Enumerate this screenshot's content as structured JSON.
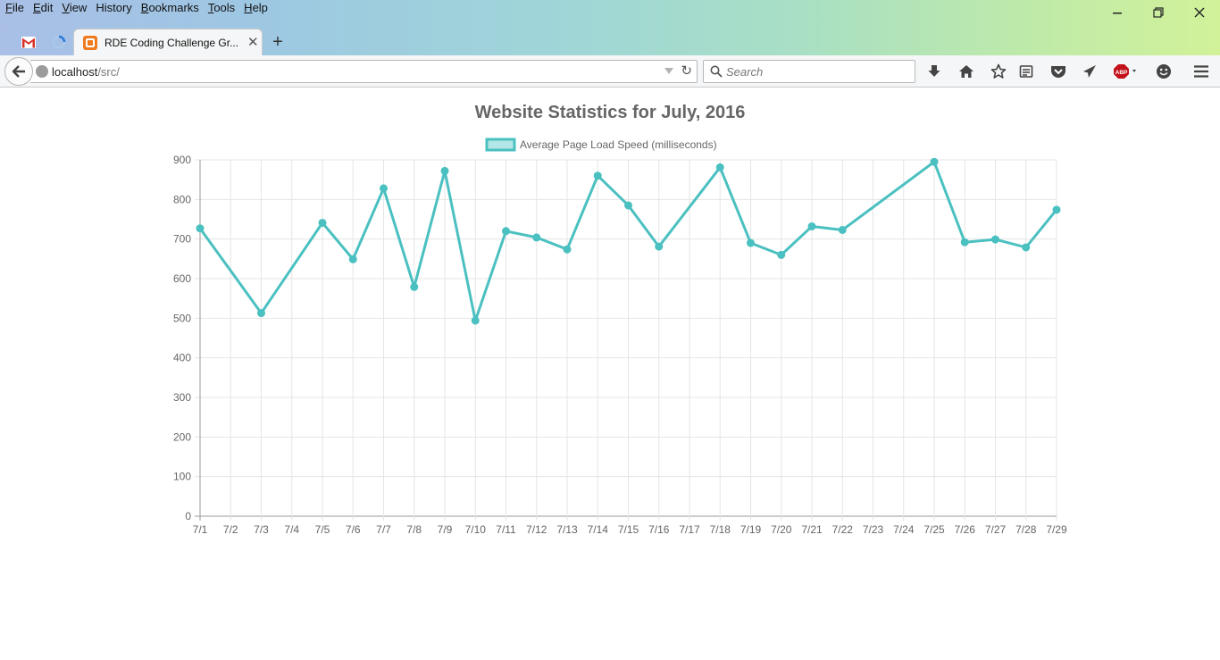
{
  "menubar": {
    "items": [
      {
        "first": "F",
        "rest": "ile"
      },
      {
        "first": "E",
        "rest": "dit"
      },
      {
        "first": "V",
        "rest": "iew"
      },
      {
        "first": "",
        "rest": "History"
      },
      {
        "first": "B",
        "rest": "ookmarks"
      },
      {
        "first": "T",
        "rest": "ools"
      },
      {
        "first": "H",
        "rest": "elp"
      }
    ]
  },
  "tab": {
    "title": "RDE Coding Challenge Gr...",
    "close": "✕"
  },
  "new_tab_symbol": "+",
  "address": {
    "host": "localhost",
    "path": "/src/"
  },
  "search": {
    "placeholder": "Search"
  },
  "toolbar_icons": [
    "download-icon",
    "home-icon",
    "bookmark-star-icon",
    "reader-list-icon",
    "pocket-icon",
    "send-icon",
    "adblock-icon",
    "smiley-icon",
    "hamburger-menu-icon"
  ],
  "adblock_label": "ABP",
  "colors": {
    "line": "#4bc0c0",
    "legend_fill": "#b3e6e6",
    "grid": "#e5e5e5",
    "text": "#666666"
  },
  "chart_data": {
    "type": "line",
    "title": "Website Statistics for July, 2016",
    "categories": [
      "7/1",
      "7/2",
      "7/3",
      "7/4",
      "7/5",
      "7/6",
      "7/7",
      "7/8",
      "7/9",
      "7/10",
      "7/11",
      "7/12",
      "7/13",
      "7/14",
      "7/15",
      "7/16",
      "7/17",
      "7/18",
      "7/19",
      "7/20",
      "7/21",
      "7/22",
      "7/23",
      "7/24",
      "7/25",
      "7/26",
      "7/27",
      "7/28",
      "7/29"
    ],
    "series": [
      {
        "name": "Average Page Load Speed (milliseconds)",
        "values": [
          727,
          null,
          513,
          null,
          741,
          649,
          828,
          579,
          872,
          494,
          720,
          704,
          674,
          860,
          785,
          681,
          null,
          881,
          690,
          660,
          732,
          723,
          null,
          null,
          895,
          692,
          699,
          679,
          774
        ]
      }
    ],
    "ylim": [
      0,
      900
    ],
    "yticks": [
      "0",
      "100",
      "200",
      "300",
      "400",
      "500",
      "600",
      "700",
      "800",
      "900"
    ],
    "grid": true,
    "legend": "top-center"
  }
}
